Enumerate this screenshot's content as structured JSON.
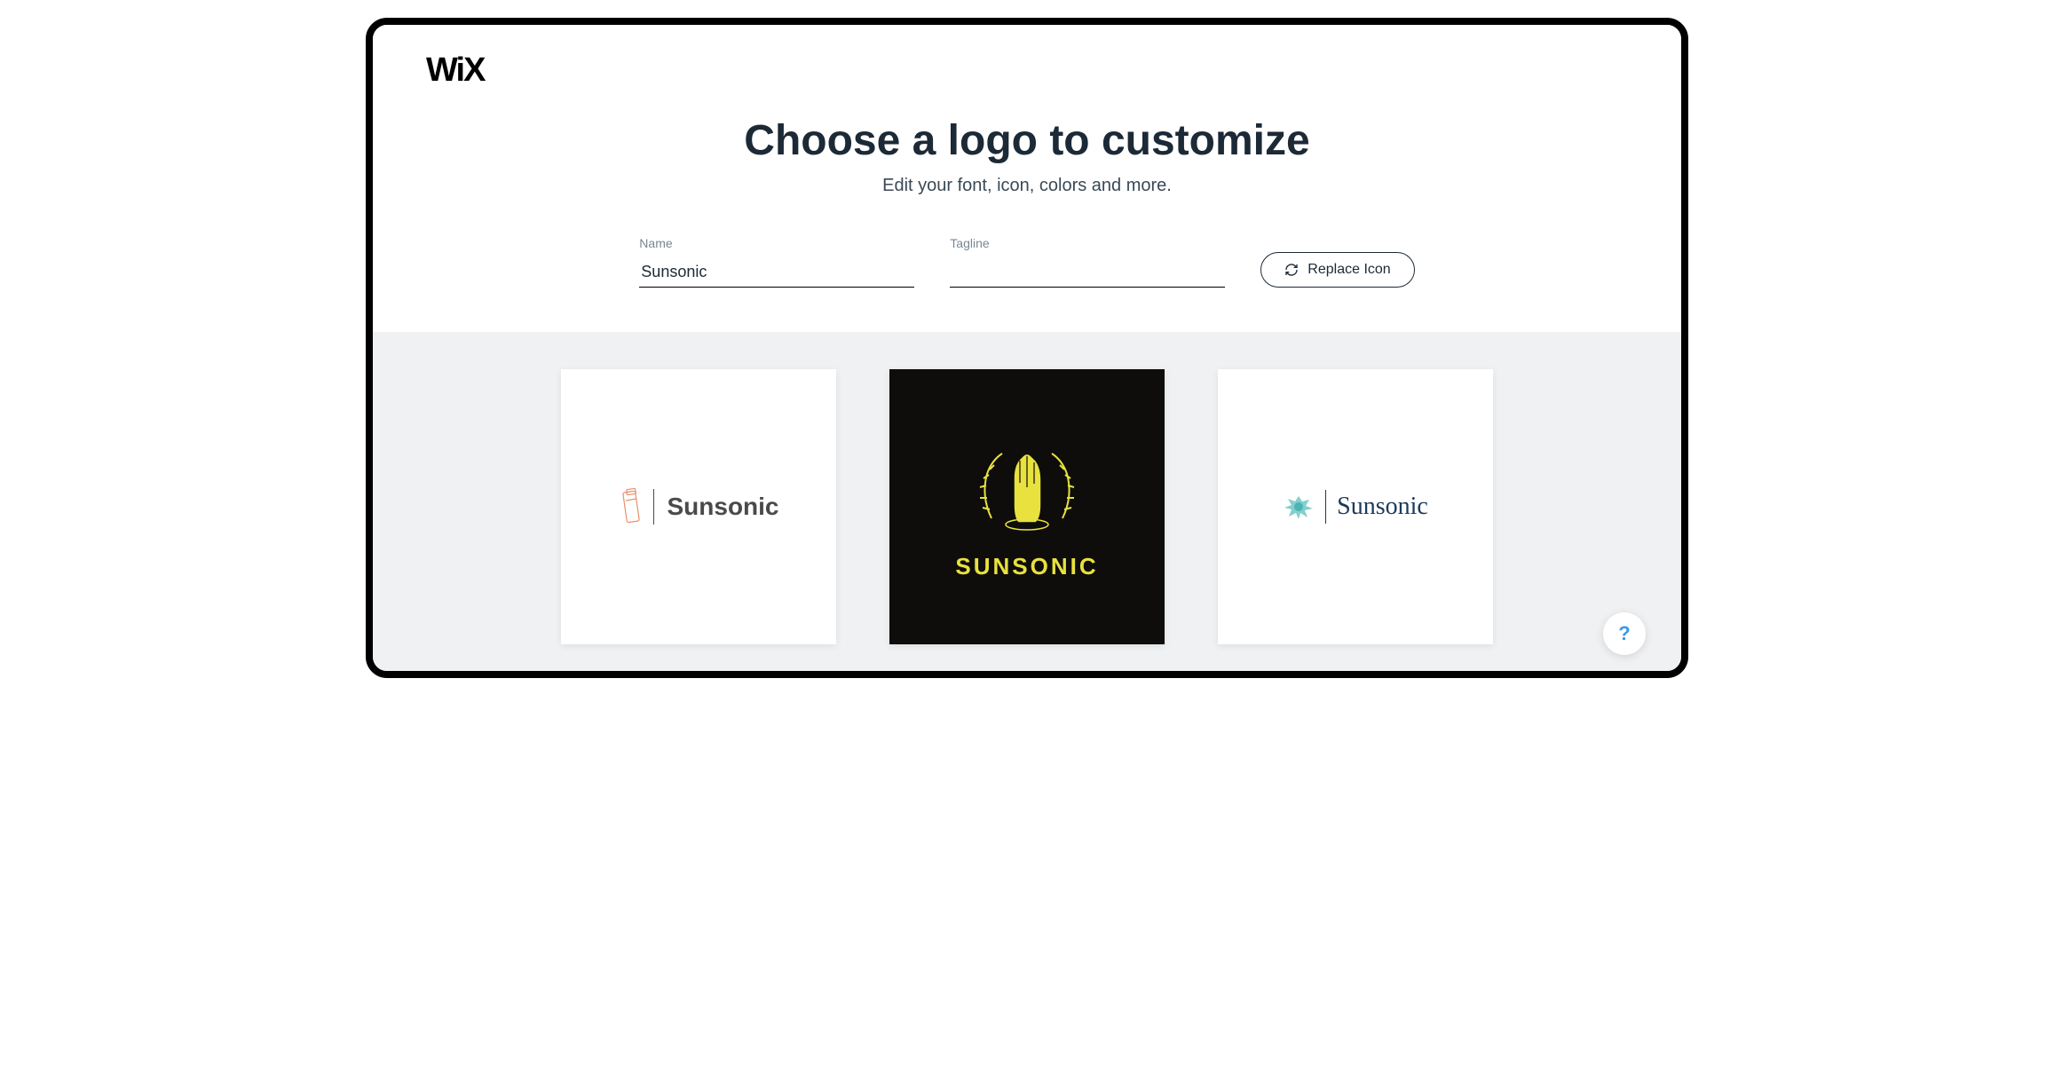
{
  "brand": "WiX",
  "header": {
    "title": "Choose a logo to customize",
    "subtitle": "Edit your font, icon, colors and more."
  },
  "form": {
    "name_label": "Name",
    "name_value": "Sunsonic",
    "tagline_label": "Tagline",
    "tagline_value": "",
    "replace_button": "Replace Icon"
  },
  "logos": [
    {
      "brand_text": "Sunsonic",
      "bg_color": "#ffffff",
      "text_color": "#4a4a4a",
      "icon_name": "bottle-outline",
      "style": "serif-divider"
    },
    {
      "brand_text": "SUNSONIC",
      "bg_color": "#0e0d0b",
      "text_color": "#e8e13e",
      "icon_name": "hand-laurel",
      "style": "stacked-bold"
    },
    {
      "brand_text": "Sunsonic",
      "bg_color": "#ffffff",
      "text_color": "#1a3a5c",
      "icon_name": "splash-teal",
      "style": "serif-divider"
    }
  ],
  "help": {
    "label": "?"
  }
}
